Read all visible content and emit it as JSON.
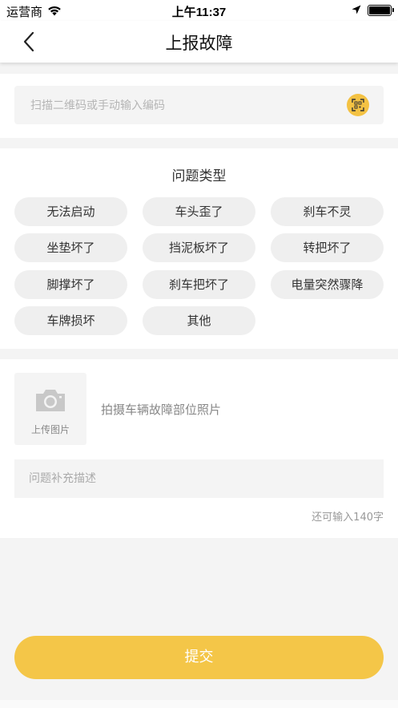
{
  "status": {
    "carrier": "运营商",
    "time": "上午11:37",
    "battery_level": 1.0
  },
  "nav": {
    "title": "上报故障",
    "back_icon": "chevron-left-icon"
  },
  "scan": {
    "placeholder": "扫描二维码或手动输入编码",
    "value": "",
    "icon": "scan-icon",
    "accent": "#f4c243"
  },
  "problem_types": {
    "title": "问题类型",
    "tags": [
      "无法启动",
      "车头歪了",
      "刹车不灵",
      "坐垫坏了",
      "挡泥板坏了",
      "转把坏了",
      "脚撑坏了",
      "刹车把坏了",
      "电量突然骤降",
      "车牌损坏",
      "其他"
    ]
  },
  "photo": {
    "upload_label": "上传图片",
    "hint": "拍摄车辆故障部位照片",
    "icon": "camera-icon"
  },
  "description": {
    "placeholder": "问题补充描述",
    "value": "",
    "counter": "还可输入140字"
  },
  "submit": {
    "label": "提交",
    "color": "#f4c648"
  }
}
